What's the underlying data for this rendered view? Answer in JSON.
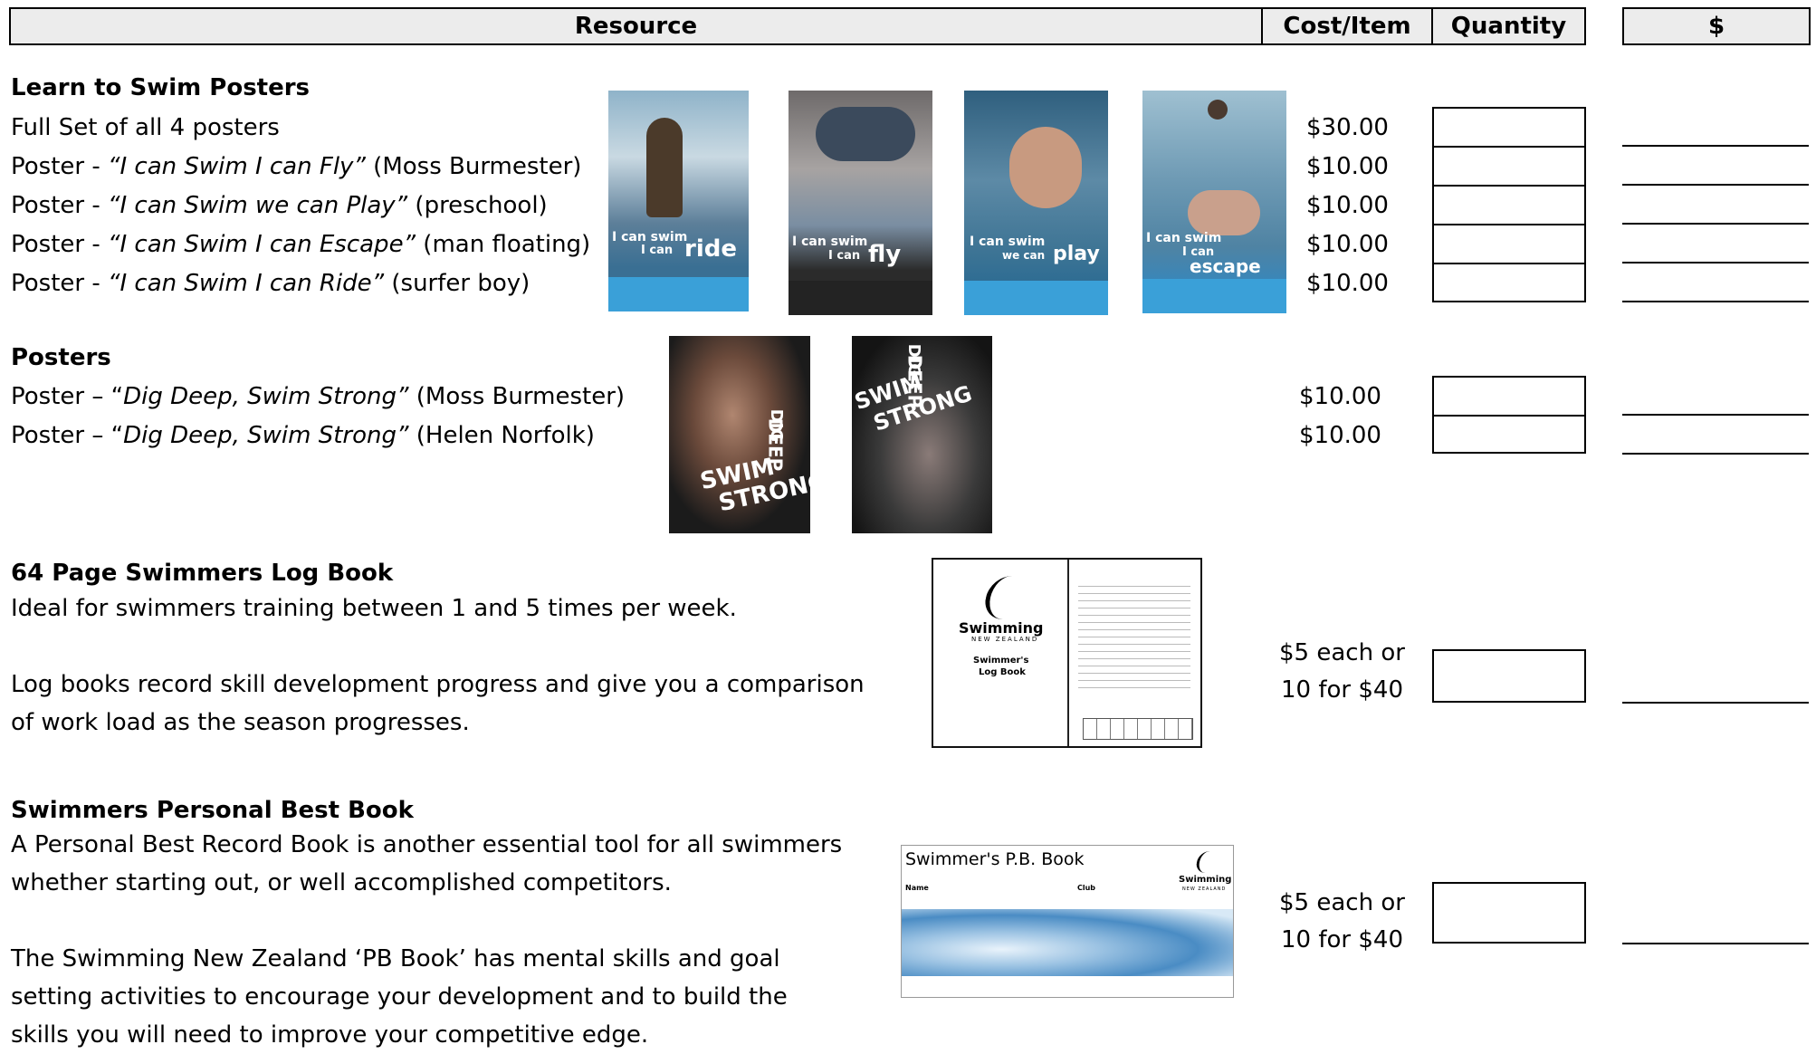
{
  "header": {
    "resource": "Resource",
    "cost_item": "Cost/Item",
    "quantity": "Quantity",
    "dollar": "$"
  },
  "learn_to_swim": {
    "title": "Learn to Swim Posters",
    "rows": [
      {
        "pre": "Full Set of all 4 posters",
        "italic": "",
        "post": "",
        "price": "$30.00"
      },
      {
        "pre": "Poster - ",
        "italic": "“I can Swim I can Fly”",
        "post": " (Moss Burmester)",
        "price": "$10.00"
      },
      {
        "pre": "Poster - ",
        "italic": "“I can Swim we can Play”",
        "post": " (preschool)",
        "price": "$10.00"
      },
      {
        "pre": "Poster - ",
        "italic": "“I can Swim I can Escape”",
        "post": " (man floating)",
        "price": "$10.00"
      },
      {
        "pre": "Poster - ",
        "italic": "“I can Swim I can Ride”",
        "post": " (surfer boy)",
        "price": "$10.00"
      }
    ],
    "posters": [
      {
        "line1": "I can swim",
        "line2": "I can",
        "big": "ride"
      },
      {
        "line1": "I can swim",
        "line2": "I can",
        "big": "fly"
      },
      {
        "line1": "I can swim",
        "line2": "we can",
        "big": "play"
      },
      {
        "line1": "I can swim",
        "line2": "I can",
        "big": "escape"
      }
    ]
  },
  "posters": {
    "title": "Posters",
    "rows": [
      {
        "pre": "Poster – “",
        "italic": "Dig Deep, Swim Strong”",
        "post": "  (Moss Burmester)",
        "price": "$10.00"
      },
      {
        "pre": "Poster – “",
        "italic": "Dig Deep, Swim Strong”",
        "post": "  (Helen Norfolk)",
        "price": "$10.00"
      }
    ],
    "poster_text": {
      "dig": "DIG",
      "deep": "DEEP",
      "swim": "SWIM",
      "strong": "STRONG"
    }
  },
  "log_book": {
    "title": "64 Page Swimmers Log Book",
    "lines": [
      "Ideal for swimmers training between 1 and 5 times per week.",
      "",
      "Log books record skill development progress and give you a comparison",
      "of work load as the season progresses."
    ],
    "price_line1": "$5 each or",
    "price_line2": "10 for $40",
    "cover_brand": "Swimming",
    "cover_sub": "NEW ZEALAND",
    "cover_title1": "Swimmer's",
    "cover_title2": "Log Book"
  },
  "pb_book": {
    "title": "Swimmers Personal Best Book",
    "lines": [
      "A Personal Best Record Book is another essential tool for all swimmers",
      "whether starting out, or well accomplished competitors.",
      "",
      "The Swimming New Zealand ‘PB Book’ has mental skills and goal",
      "setting activities to encourage your development and to build the",
      "skills you will need to improve your competitive edge."
    ],
    "price_line1": "$5 each or",
    "price_line2": "10 for $40",
    "cover_title": "Swimmer's P.B. Book",
    "cover_name": "Name",
    "cover_club": "Club",
    "cover_brand": "Swimming",
    "cover_sub": "NEW ZEALAND"
  }
}
